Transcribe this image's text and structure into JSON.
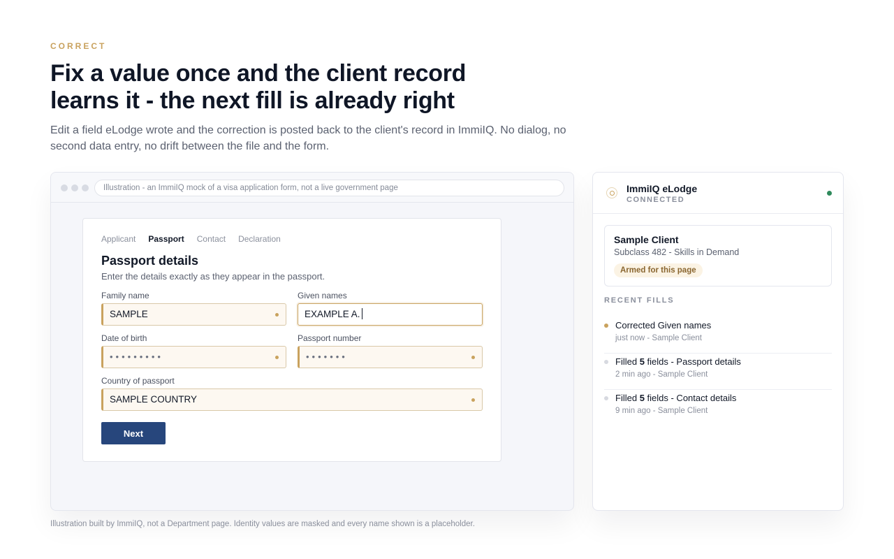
{
  "hero": {
    "eyebrow": "CORRECT",
    "headline": "Fix a value once and the client record learns it - the next fill is already right",
    "lede": "Edit a field eLodge wrote and the correction is posted back to the client's record in ImmiIQ. No dialog, no second data entry, no drift between the file and the form."
  },
  "browser": {
    "address": "Illustration - an ImmiIQ mock of a visa application form, not a live government page"
  },
  "form": {
    "tabs": [
      {
        "label": "Applicant",
        "active": false
      },
      {
        "label": "Passport",
        "active": true
      },
      {
        "label": "Contact",
        "active": false
      },
      {
        "label": "Declaration",
        "active": false
      }
    ],
    "title": "Passport details",
    "subtitle": "Enter the details exactly as they appear in the passport.",
    "fields": {
      "family_name": {
        "label": "Family name",
        "value": "SAMPLE"
      },
      "given_names": {
        "label": "Given names",
        "value": "EXAMPLE A."
      },
      "dob": {
        "label": "Date of birth",
        "value": "•••••••••"
      },
      "passport_number": {
        "label": "Passport number",
        "value": "•••••••"
      },
      "country": {
        "label": "Country of passport",
        "value": "SAMPLE COUNTRY"
      }
    },
    "next_label": "Next"
  },
  "panel": {
    "title": "ImmiIQ eLodge",
    "status": "CONNECTED",
    "status_color": "#2f8a5c",
    "client": {
      "name": "Sample Client",
      "subclass": "Subclass 482 - Skills in Demand",
      "badge": "Armed for this page"
    },
    "recent_label": "RECENT FILLS",
    "fills": [
      {
        "title_prefix": "Corrected Given names",
        "count": "",
        "title_suffix": "",
        "meta": "just now - Sample Client",
        "accent": true
      },
      {
        "title_prefix": "Filled ",
        "count": "5",
        "title_suffix": " fields - Passport details",
        "meta": "2 min ago - Sample Client",
        "accent": false
      },
      {
        "title_prefix": "Filled ",
        "count": "5",
        "title_suffix": " fields - Contact details",
        "meta": "9 min ago - Sample Client",
        "accent": false
      }
    ]
  },
  "footnote": "Illustration built by ImmiIQ, not a Department page. Identity values are masked and every name shown is a placeholder.",
  "colors": {
    "accent": "#c9a25e",
    "primary_button": "#27467c"
  }
}
